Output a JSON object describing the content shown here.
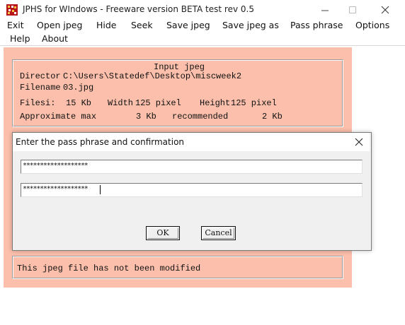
{
  "window": {
    "title": "JPHS for WIndows - Freeware version BETA test rev 0.5",
    "minimize_label": "—",
    "maximize_label": "☐",
    "close_label": "✕"
  },
  "menu": {
    "items": [
      "Exit",
      "Open jpeg",
      "Hide",
      "Seek",
      "Save jpeg",
      "Save jpeg as",
      "Pass phrase",
      "Options"
    ],
    "items_row2": [
      "Help",
      "About"
    ]
  },
  "input_jpeg": {
    "heading": "Input jpeg",
    "directory_label": "Director",
    "directory_value": "C:\\Users\\Statedef\\Desktop\\miscweek2",
    "filename_label": "Filename",
    "filename_value": "03.jpg",
    "filesize_label": "Filesi:",
    "filesize_value": "15 Kb",
    "width_label": "Width",
    "width_value": "125 pixel",
    "height_label": "Height",
    "height_value": "125 pixel",
    "approx_label": "Approximate max",
    "approx_value": "3 Kb",
    "recommended_label": "recommended",
    "recommended_value": "2 Kb"
  },
  "status": {
    "message": "This jpeg file has not been modified"
  },
  "dialog": {
    "title": "Enter the pass phrase and confirmation",
    "pass_value": "*******************",
    "confirm_value": "*******************",
    "ok_label": "OK",
    "cancel_label": "Cancel"
  },
  "colors": {
    "panel_bg": "#fbbfab",
    "dialog_bg": "#f0f0f0"
  }
}
